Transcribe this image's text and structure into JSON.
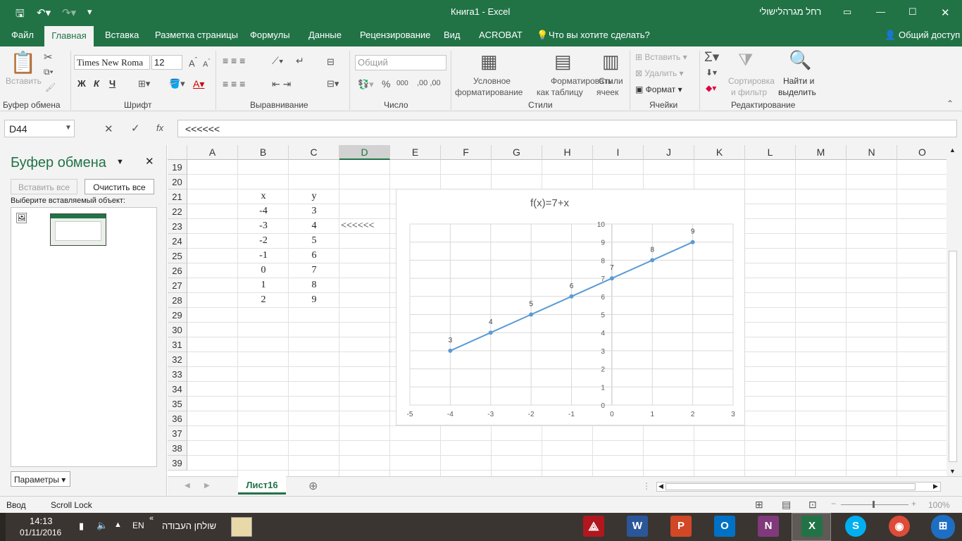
{
  "window": {
    "title": "Книга1  -  Excel",
    "user": "רחל מגרהלישולי"
  },
  "tabs": [
    "Файл",
    "Главная",
    "Вставка",
    "Разметка страницы",
    "Формулы",
    "Данные",
    "Рецензирование",
    "Вид",
    "ACROBAT"
  ],
  "tell_me": "Что вы хотите сделать?",
  "share": "Общий доступ",
  "ribbon": {
    "paste": "Вставить",
    "font_name": "Times New Roma",
    "font_size": "12",
    "bold": "Ж",
    "italic": "К",
    "underline": "Ч",
    "number_format": "Общий",
    "conditional": "Условное",
    "conditional2": "форматирование",
    "format_table": "Форматировать",
    "format_table2": "как таблицу",
    "cell_styles": "Стили",
    "cell_styles2": "ячеек",
    "insert": "Вставить",
    "delete": "Удалить",
    "format": "Формат",
    "sort": "Сортировка",
    "sort2": "и фильтр",
    "find": "Найти и",
    "find2": "выделить",
    "groups": {
      "clipboard": "Буфер обмена",
      "font": "Шрифт",
      "alignment": "Выравнивание",
      "number": "Число",
      "styles": "Стили",
      "cells": "Ячейки",
      "editing": "Редактирование"
    }
  },
  "name_box": "D44",
  "formula": "<<<<<<",
  "clipboard_pane": {
    "title": "Буфер обмена",
    "paste_all": "Вставить все",
    "clear_all": "Очистить все",
    "prompt": "Выберите вставляемый объект:",
    "options": "Параметры"
  },
  "columns": [
    "A",
    "B",
    "C",
    "D",
    "E",
    "F",
    "G",
    "H",
    "I",
    "J",
    "K",
    "L",
    "M",
    "N",
    "O"
  ],
  "rows": [
    "19",
    "20",
    "21",
    "22",
    "23",
    "24",
    "25",
    "26",
    "27",
    "28",
    "29",
    "30",
    "31",
    "32",
    "33",
    "34",
    "35",
    "36",
    "37",
    "38",
    "39"
  ],
  "table": {
    "x_header": "x",
    "y_header": "y",
    "x": [
      "-4",
      "-3",
      "-2",
      "-1",
      "0",
      "1",
      "2"
    ],
    "y": [
      "3",
      "4",
      "5",
      "6",
      "7",
      "8",
      "9"
    ],
    "d23": "<<<<<<"
  },
  "chart_data": {
    "type": "scatter",
    "title": "f(x)=7+x",
    "x": [
      -4,
      -3,
      -2,
      -1,
      0,
      1,
      2
    ],
    "y": [
      3,
      4,
      5,
      6,
      7,
      8,
      9
    ],
    "data_labels": [
      "3",
      "4",
      "5",
      "6",
      "7",
      "8",
      "9"
    ],
    "xlim": [
      -5,
      3
    ],
    "ylim": [
      0,
      10
    ],
    "x_ticks": [
      "-5",
      "-4",
      "-3",
      "-2",
      "-1",
      "0",
      "1",
      "2",
      "3"
    ],
    "y_ticks": [
      "0",
      "1",
      "2",
      "3",
      "4",
      "5",
      "6",
      "7",
      "8",
      "9",
      "10"
    ],
    "grid": true,
    "color": "#5b9bd5"
  },
  "sheet_tab": "Лист16",
  "status": {
    "mode": "Ввод",
    "scroll_lock": "Scroll Lock",
    "zoom": "100%"
  },
  "taskbar": {
    "time": "14:13",
    "date": "01/11/2016",
    "lang": "EN",
    "desktop": "שולחן העבודה"
  }
}
